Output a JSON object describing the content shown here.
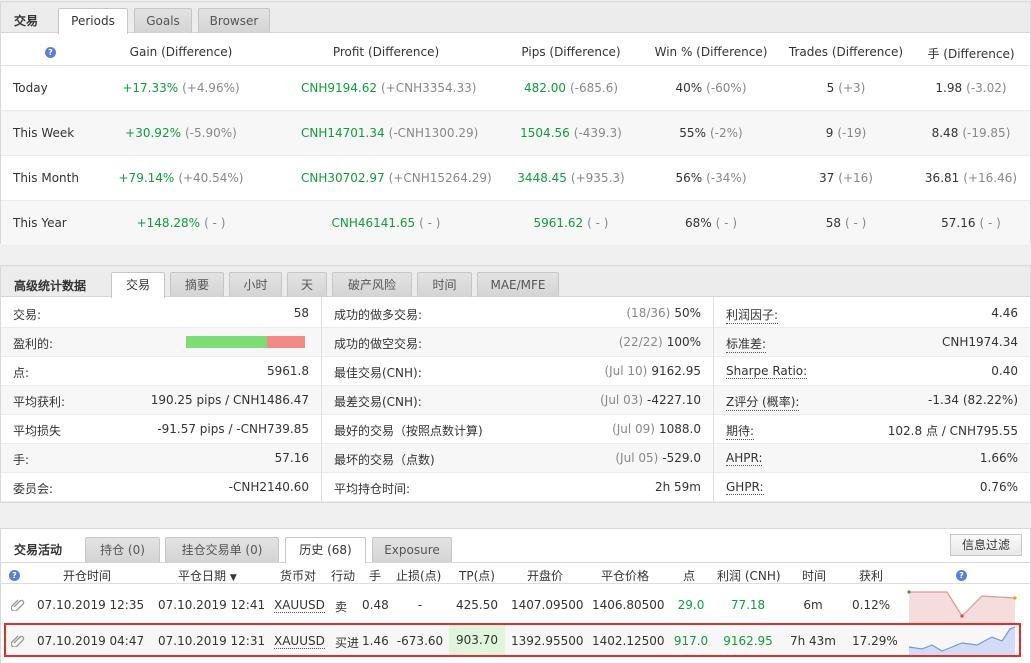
{
  "periods_panel": {
    "title": "交易",
    "tabs": [
      "Periods",
      "Goals",
      "Browser"
    ],
    "headers": [
      "Gain (Difference)",
      "Profit (Difference)",
      "Pips (Difference)",
      "Win % (Difference)",
      "Trades (Difference)",
      "手 (Difference)"
    ],
    "rows": [
      {
        "label": "Today",
        "gain": "+17.33%",
        "gain_diff": "(+4.96%)",
        "profit": "CNH9194.62",
        "profit_diff": "(+CNH3354.33)",
        "pips": "482.00",
        "pips_diff": "(-685.6)",
        "win": "40%",
        "win_diff": "(-60%)",
        "trades": "5",
        "trades_diff": "(+3)",
        "lots": "1.98",
        "lots_diff": "(-3.02)"
      },
      {
        "label": "This Week",
        "gain": "+30.92%",
        "gain_diff": "(-5.90%)",
        "profit": "CNH14701.34",
        "profit_diff": "(-CNH1300.29)",
        "pips": "1504.56",
        "pips_diff": "(-439.3)",
        "win": "55%",
        "win_diff": "(-2%)",
        "trades": "9",
        "trades_diff": "(-19)",
        "lots": "8.48",
        "lots_diff": "(-19.85)"
      },
      {
        "label": "This Month",
        "gain": "+79.14%",
        "gain_diff": "(+40.54%)",
        "profit": "CNH30702.97",
        "profit_diff": "(+CNH15264.29)",
        "pips": "3448.45",
        "pips_diff": "(+935.3)",
        "win": "56%",
        "win_diff": "(-34%)",
        "trades": "37",
        "trades_diff": "(+16)",
        "lots": "36.81",
        "lots_diff": "(+16.46)"
      },
      {
        "label": "This Year",
        "gain": "+148.28%",
        "gain_diff": "( - )",
        "profit": "CNH46141.65",
        "profit_diff": "( - )",
        "pips": "5961.62",
        "pips_diff": "( - )",
        "win": "68%",
        "win_diff": "( - )",
        "trades": "58",
        "trades_diff": "( - )",
        "lots": "57.16",
        "lots_diff": "( - )"
      }
    ]
  },
  "stats_panel": {
    "title": "高级统计数据",
    "tabs": [
      "交易",
      "摘要",
      "小时",
      "天",
      "破产风险",
      "时间",
      "MAE/MFE"
    ],
    "col1": [
      {
        "label": "交易:",
        "value": "58"
      },
      {
        "label": "盈利的:",
        "value": "",
        "bar": {
          "win_fraction": 0.68,
          "win_color": "#7ddc73",
          "loss_color": "#f38a86"
        }
      },
      {
        "label": "点:",
        "value": "5961.8"
      },
      {
        "label": "平均获利:",
        "value": "190.25 pips / CNH1486.47"
      },
      {
        "label": "平均损失",
        "value": "-91.57 pips / -CNH739.85"
      },
      {
        "label": "手:",
        "value": "57.16"
      },
      {
        "label": "委员会:",
        "value": "-CNH2140.60"
      }
    ],
    "col2": [
      {
        "label": "成功的做多交易:",
        "note": "(18/36)",
        "value": "50%"
      },
      {
        "label": "成功的做空交易:",
        "note": "(22/22)",
        "value": "100%"
      },
      {
        "label": "最佳交易(CNH):",
        "note": "(Jul 10)",
        "value": "9162.95"
      },
      {
        "label": "最差交易(CNH):",
        "note": "(Jul 03)",
        "value": "-4227.10"
      },
      {
        "label": "最好的交易（按照点数计算)",
        "note": "(Jul 09)",
        "value": "1088.0"
      },
      {
        "label": "最坏的交易（点数)",
        "note": "(Jul 05)",
        "value": "-529.0"
      },
      {
        "label": "平均持仓时间:",
        "note": "",
        "value": "2h 59m"
      }
    ],
    "col3": [
      {
        "label": "利润因子:",
        "value": "4.46"
      },
      {
        "label": "标准差:",
        "value": "CNH1974.34"
      },
      {
        "label": "Sharpe Ratio:",
        "value": "0.40"
      },
      {
        "label": "Z评分 (概率):",
        "value": "-1.34 (82.22%)"
      },
      {
        "label": "期待:",
        "value": "102.8 点 / CNH795.55"
      },
      {
        "label": "AHPR:",
        "value": "1.66%"
      },
      {
        "label": "GHPR:",
        "value": "0.76%"
      }
    ]
  },
  "trades_panel": {
    "title": "交易活动",
    "tabs": [
      "持仓 (0)",
      "挂仓交易单 (0)",
      "历史 (68)",
      "Exposure"
    ],
    "filter_label": "信息过滤",
    "headers": [
      "开仓时间",
      "平仓日期",
      "货币对",
      "行动",
      "手",
      "止损(点)",
      "TP(点)",
      "开盘价",
      "平仓价格",
      "点",
      "利润 (CNH)",
      "时间",
      "获利"
    ],
    "rows": [
      {
        "open": "07.10.2019 12:35",
        "close": "07.10.2019 12:41",
        "symbol": "XAUUSD",
        "action": "卖",
        "lots": "0.48",
        "sl": "-",
        "tp": "425.50",
        "open_price": "1407.09500",
        "close_price": "1406.80500",
        "pips": "29.0",
        "profit": "77.18",
        "duration": "6m",
        "gain": "0.12%",
        "spark_color": "#d99a9a",
        "highlight": false
      },
      {
        "open": "07.10.2019 04:47",
        "close": "07.10.2019 12:31",
        "symbol": "XAUUSD",
        "action": "买进",
        "lots": "1.46",
        "sl": "-673.60",
        "tp": "903.70",
        "open_price": "1392.95500",
        "close_price": "1402.12500",
        "pips": "917.0",
        "profit": "9162.95",
        "duration": "7h 43m",
        "gain": "17.29%",
        "spark_color": "#7a95d8",
        "highlight": true
      }
    ]
  },
  "colors": {
    "green": "#0f9d3a",
    "gray": "#888888",
    "highlight_border": "#d9322e",
    "tp_bg": "#dff5dc"
  }
}
